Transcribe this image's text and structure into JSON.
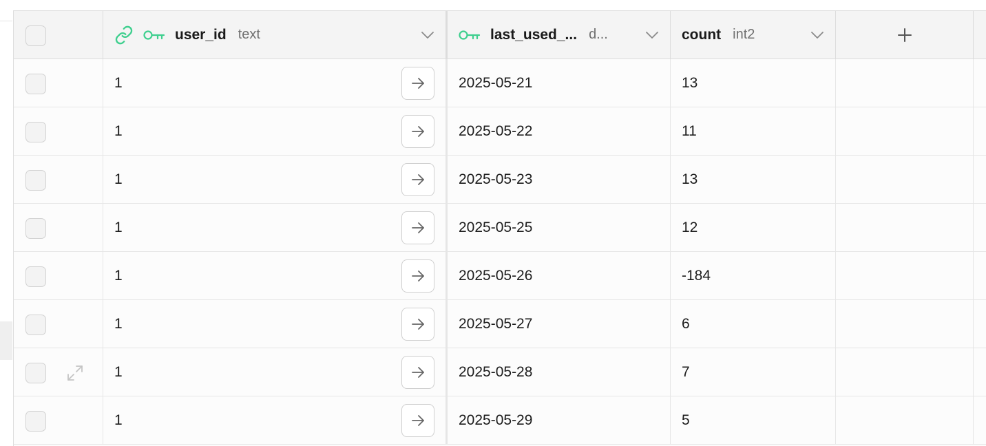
{
  "table": {
    "columns": [
      {
        "name": "user_id",
        "type": "text",
        "is_primary_key": true,
        "is_foreign_key": true
      },
      {
        "name": "last_used_...",
        "type": "d...",
        "is_primary_key": true,
        "is_foreign_key": false
      },
      {
        "name": "count",
        "type": "int2",
        "is_primary_key": false,
        "is_foreign_key": false
      }
    ],
    "rows": [
      {
        "user_id": "1",
        "last_used": "2025-05-21",
        "count": "13"
      },
      {
        "user_id": "1",
        "last_used": "2025-05-22",
        "count": "11"
      },
      {
        "user_id": "1",
        "last_used": "2025-05-23",
        "count": "13"
      },
      {
        "user_id": "1",
        "last_used": "2025-05-25",
        "count": "12"
      },
      {
        "user_id": "1",
        "last_used": "2025-05-26",
        "count": "-184"
      },
      {
        "user_id": "1",
        "last_used": "2025-05-27",
        "count": "6"
      },
      {
        "user_id": "1",
        "last_used": "2025-05-28",
        "count": "7"
      },
      {
        "user_id": "1",
        "last_used": "2025-05-29",
        "count": "5"
      }
    ]
  },
  "icons": {
    "foreign_key": "link-icon",
    "primary_key": "key-icon",
    "column_menu": "chevron-down-icon",
    "add_column": "plus-icon",
    "row_link": "arrow-right-icon",
    "row_expand": "expand-icon"
  },
  "colors": {
    "key_green": "#3ecf8e",
    "header_bg": "#f4f4f4",
    "cell_bg": "#fcfcfc",
    "border": "#e6e6e6"
  }
}
